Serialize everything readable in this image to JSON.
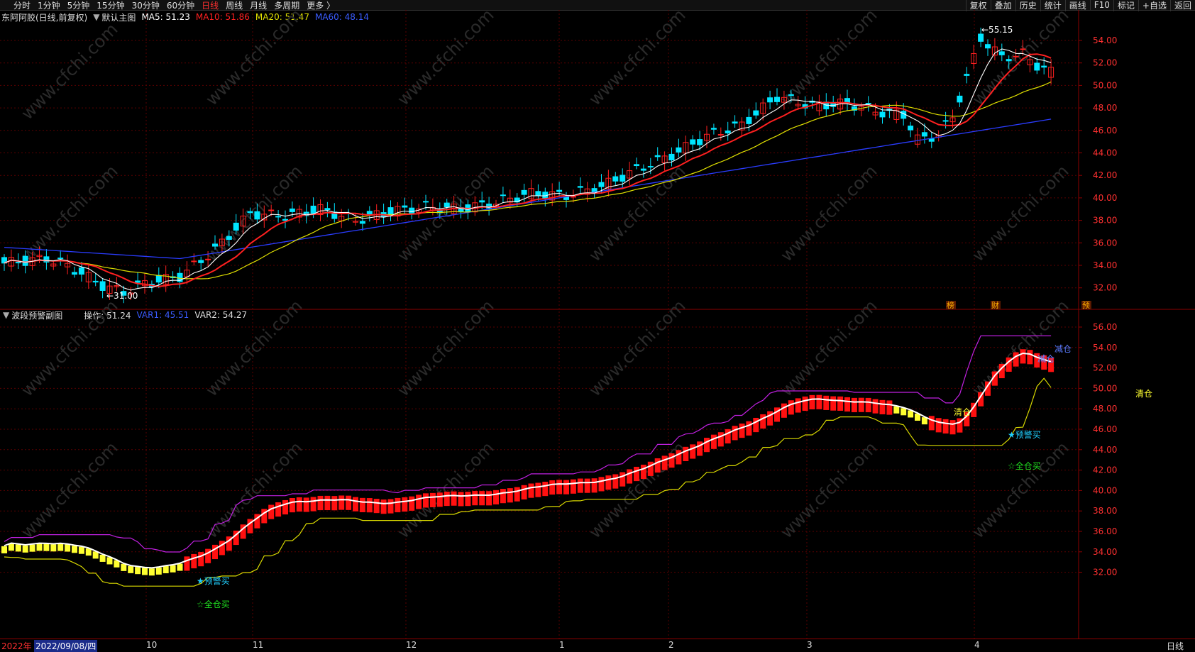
{
  "topbar": {
    "periods": [
      "分时",
      "1分钟",
      "5分钟",
      "15分钟",
      "30分钟",
      "60分钟",
      "日线",
      "周线",
      "月线",
      "多周期",
      "更多 〉"
    ],
    "active_period": "日线",
    "right_tools": [
      "复权",
      "叠加",
      "历史",
      "统计",
      "画线",
      "F10",
      "+自选",
      "返回"
    ],
    "right_extra": "标记"
  },
  "main_panel": {
    "stock": "东阿阿胶(日线,前复权)",
    "template": "默认主图",
    "ma": [
      {
        "label": "MA5: 51.23",
        "color": "#ffffff"
      },
      {
        "label": "MA10: 51.86",
        "color": "#ff2020"
      },
      {
        "label": "MA20: 51.47",
        "color": "#e0e000"
      },
      {
        "label": "MA60: 48.14",
        "color": "#2a3cff"
      }
    ],
    "y_ticks": [
      "54.00",
      "52.00",
      "50.00",
      "48.00",
      "46.00",
      "44.00",
      "42.00",
      "40.00",
      "38.00",
      "36.00",
      "34.00",
      "32.00"
    ],
    "y_values": [
      54,
      52,
      50,
      48,
      46,
      44,
      42,
      40,
      38,
      36,
      34,
      32
    ],
    "high_label": "55.15",
    "low_label": "31.00",
    "event_marks": [
      "榜",
      "财",
      "预"
    ]
  },
  "sub_panel": {
    "title": "波段预警副图",
    "op": "操作: 51.24",
    "var1": "VAR1: 45.51",
    "var2": "VAR2: 54.27",
    "y_ticks": [
      "56.00",
      "54.00",
      "52.00",
      "50.00",
      "48.00",
      "46.00",
      "44.00",
      "42.00",
      "40.00",
      "38.00",
      "36.00",
      "34.00",
      "32.00"
    ],
    "y_values": [
      56,
      54,
      52,
      50,
      48,
      46,
      44,
      42,
      40,
      38,
      36,
      34,
      32
    ],
    "signals": {
      "alert_buy_1": "★预警买",
      "full_buy_1": "☆全仓买",
      "clear_1": "清仓",
      "alert_buy_2": "★预警买",
      "full_buy_2": "☆全仓买",
      "reduce_top": "减仓",
      "reduce": "减仓",
      "clear_2": "清仓"
    }
  },
  "time_axis": {
    "year": "2022年",
    "cursor_date": "2022/09/08/四",
    "months": [
      "10",
      "11",
      "12",
      "1",
      "2",
      "3",
      "4"
    ],
    "right_label": "日线"
  },
  "colors": {
    "up": "#ff2020",
    "down": "#00e5ff",
    "ma5": "#ffffff",
    "ma10": "#ff2020",
    "ma20": "#e0e000",
    "ma60": "#2a3cff",
    "grid": "#5a0000"
  },
  "watermark": "www.cfchi.com"
}
